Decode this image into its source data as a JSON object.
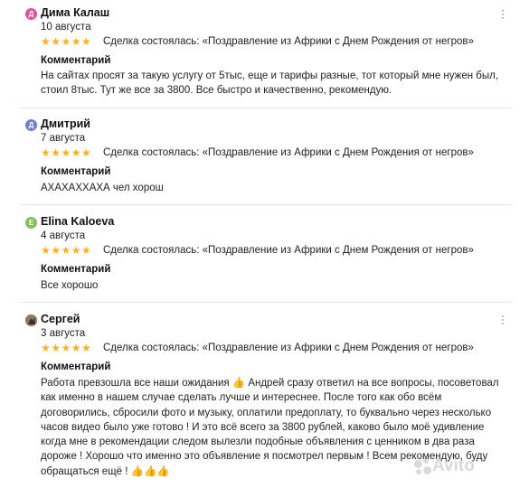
{
  "reviews": [
    {
      "avatar_letter": "Д",
      "avatar_color": "#e0539b",
      "name": "Дима Калаш",
      "date": "10 августа",
      "stars": "★★★★★",
      "deal": "Сделка состоялась: «Поздравление из Африки с Днем Рождения от негров»",
      "comment_label": "Комментарий",
      "comment": "На сайтах просят за такую услугу от 5тыс, еще и тарифы разные, тот который мне нужен был, стоил 8тыс. Тут же все за 3800. Все быстро и качественно, рекомендую."
    },
    {
      "avatar_letter": "Д",
      "avatar_color": "#6c7fd1",
      "name": "Дмитрий",
      "date": "7 августа",
      "stars": "★★★★★",
      "deal": "Сделка состоялась: «Поздравление из Африки с Днем Рождения от негров»",
      "comment_label": "Комментарий",
      "comment": "АХАХАХХАХА чел хорош"
    },
    {
      "avatar_letter": "E",
      "avatar_color": "#7fc25a",
      "name": "Elina Kaloeva",
      "date": "4 августа",
      "stars": "★★★★★",
      "deal": "Сделка состоялась: «Поздравление из Африки с Днем Рождения от негров»",
      "comment_label": "Комментарий",
      "comment": "Все хорошо"
    },
    {
      "avatar_letter": "",
      "avatar_color": "#6b5a4e",
      "name": "Сергей",
      "date": "3 августа",
      "stars": "★★★★★",
      "deal": "Сделка состоялась: «Поздравление из Африки с Днем Рождения от негров»",
      "comment_label": "Комментарий",
      "comment": "Работа превзошла все наши ожидания 👍 Андрей сразу ответил на все вопросы, посоветовал как именно в нашем случае сделать лучше и интереснее. После того как обо всём договорились, сбросили фото и музыку, оплатили предоплату, то буквально через несколько часов видео было уже готово ! И это всё всего за 3800 рублей, каково было моё удивление когда мне в рекомендации следом вылезли подобные объявления с ценником в два раза дороже ! Хорошо что именно это объявление я посмотрел первым ! Всем рекомендую, буду обращаться ещё ! 👍👍👍"
    }
  ],
  "menu_icon": "more-vertical-icon",
  "watermark": "Avito"
}
